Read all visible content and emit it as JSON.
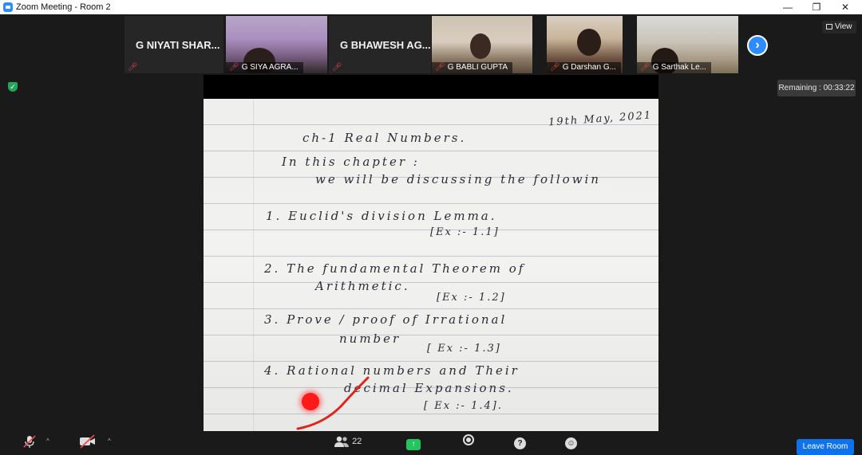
{
  "window": {
    "title": "Zoom Meeting - Room 2",
    "controls": {
      "minimize": "—",
      "maximize": "❐",
      "close": "✕"
    }
  },
  "gallery": {
    "tiles": [
      {
        "big_name": "G NIYATI SHAR...",
        "label": "",
        "muted": true,
        "video": false
      },
      {
        "big_name": "",
        "label": "G SIYA AGRA...",
        "muted": true,
        "video": true
      },
      {
        "big_name": "G BHAWESH AG...",
        "label": "",
        "muted": true,
        "video": false
      },
      {
        "big_name": "",
        "label": "G BABLI GUPTA",
        "muted": true,
        "video": true
      },
      {
        "big_name": "",
        "label": "G Darshan G...",
        "muted": true,
        "video": true
      },
      {
        "big_name": "",
        "label": "G Sarthak Le...",
        "muted": true,
        "video": true
      }
    ],
    "next_icon": "chevron-right-icon"
  },
  "view_button": {
    "label": "View",
    "icon": "grid-icon"
  },
  "remaining": "Remaining : 00:33:22",
  "share": {
    "notes": {
      "date": "19th May, 2021",
      "heading": "ch-1 Real Numbers.",
      "intro1": "In this chapter :",
      "intro2": "we will be discussing the followin",
      "i1": "1.  Euclid's division Lemma.",
      "i1ex": "[Ex :- 1.1]",
      "i2": "2.  The fundamental Theorem of",
      "i2b": "Arithmetic.",
      "i2ex": "[Ex :- 1.2]",
      "i3": "3.  Prove / proof of Irrational",
      "i3b": "number",
      "i3ex": "[ Ex :- 1.3]",
      "i4": "4.  Rational numbers and Their",
      "i4b": "decimal Expansions.",
      "i4ex": "[ Ex :- 1.4]."
    }
  },
  "toolbar": {
    "participants_count": "22",
    "leave": "Leave Room",
    "accent": "#0e72ed",
    "share_color": "#23c55e",
    "mute_color": "#e5484d"
  }
}
